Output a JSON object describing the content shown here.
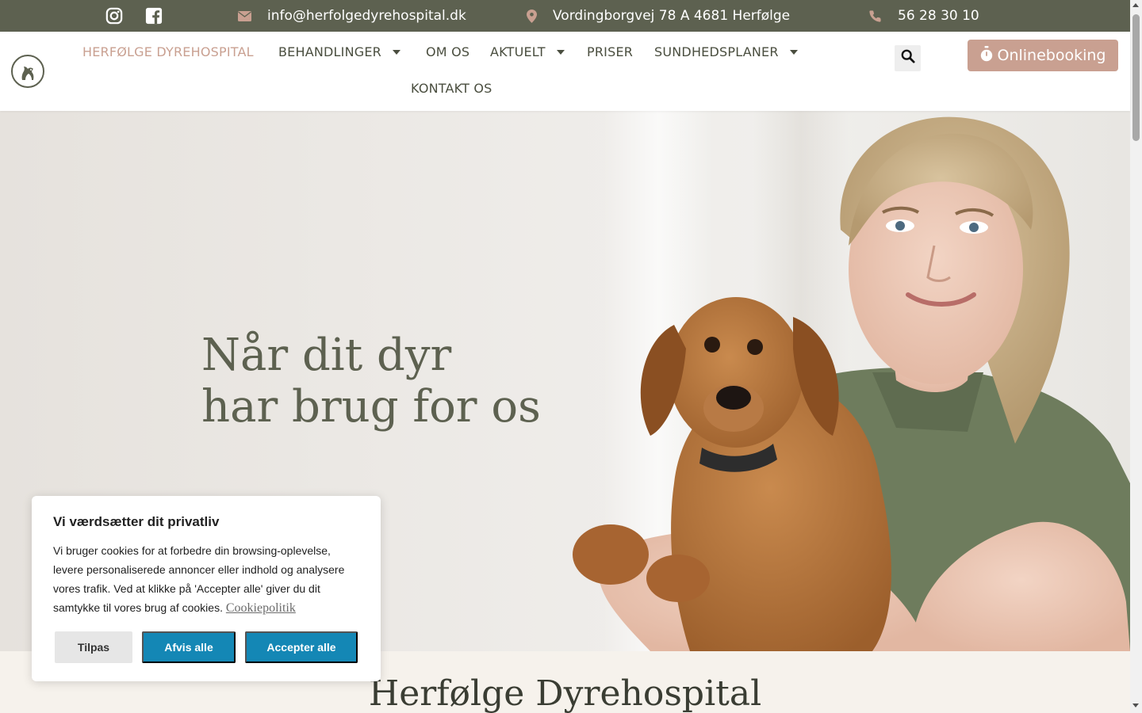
{
  "topbar": {
    "email": "info@herfolgedyrehospital.dk",
    "address": "Vordingborgvej 78 A 4681 Herfølge",
    "phone": "56 28 30 10"
  },
  "nav": {
    "items": [
      {
        "label": "HERFØLGE DYREHOSPITAL",
        "active": true,
        "dropdown": false
      },
      {
        "label": "BEHANDLINGER",
        "active": false,
        "dropdown": true
      },
      {
        "label": "OM OS",
        "active": false,
        "dropdown": false
      },
      {
        "label": "AKTUELT",
        "active": false,
        "dropdown": true
      },
      {
        "label": "PRISER",
        "active": false,
        "dropdown": false
      },
      {
        "label": "SUNDHEDSPLANER",
        "active": false,
        "dropdown": true
      },
      {
        "label": "KONTAKT OS",
        "active": false,
        "dropdown": false
      }
    ],
    "booking_label": "Onlinebooking"
  },
  "hero": {
    "title_line1": "Når dit dyr",
    "title_line2": "har brug for os"
  },
  "section2": {
    "title": "Herfølge Dyrehospital"
  },
  "cookie": {
    "title": "Vi værdsætter dit privatliv",
    "text": "Vi bruger cookies for at forbedre din browsing-oplevelse, levere personaliserede annoncer eller indhold og analysere vores trafik. Ved at klikke på 'Accepter alle' giver du dit samtykke til vores brug af cookies.",
    "link": "Cookiepolitik",
    "customize_label": "Tilpas",
    "reject_label": "Afvis alle",
    "accept_label": "Accepter alle"
  },
  "colors": {
    "olive": "#5d6150",
    "rose": "#c9a091",
    "cookie_blue": "#1487b5",
    "section_bg": "#f6f2ec"
  },
  "icons": [
    "instagram-icon",
    "facebook-icon",
    "envelope-icon",
    "map-pin-icon",
    "phone-icon",
    "search-icon",
    "stopwatch-icon",
    "logo-icon"
  ]
}
